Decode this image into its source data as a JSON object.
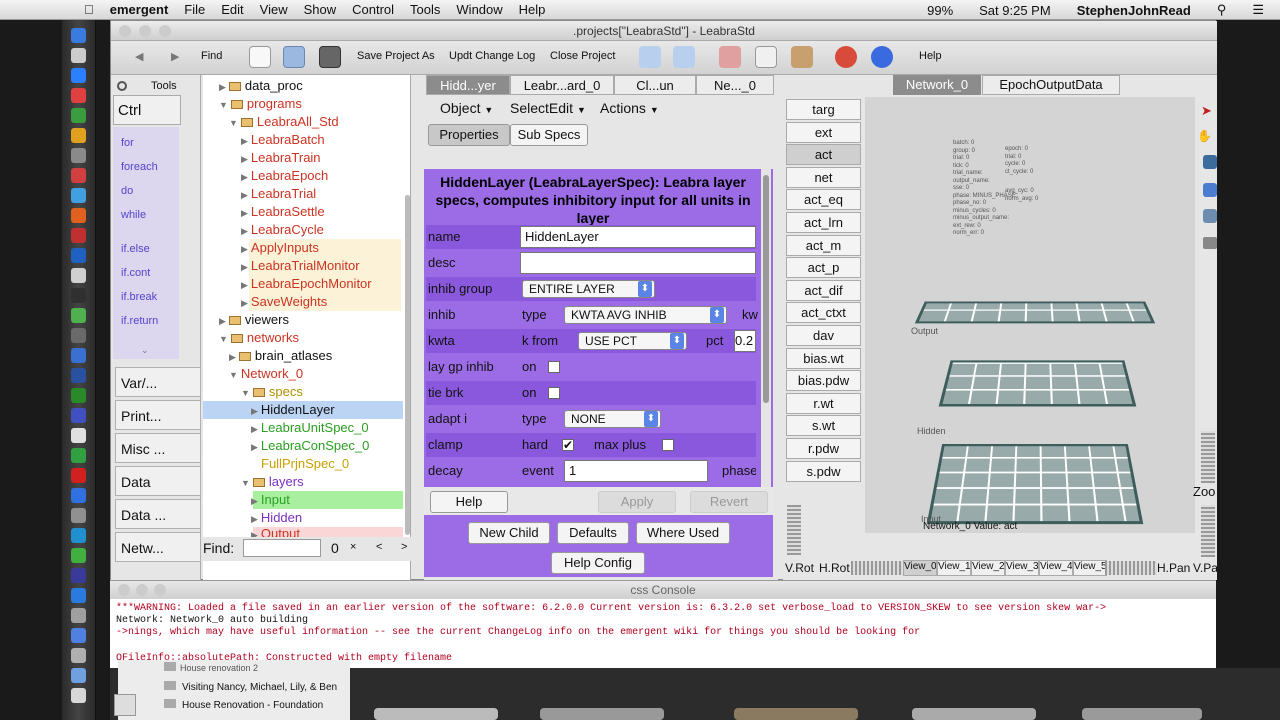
{
  "menubar": {
    "items": [
      "emergent",
      "File",
      "Edit",
      "View",
      "Show",
      "Control",
      "Tools",
      "Window",
      "Help"
    ],
    "battery": "99%",
    "clock": "Sat 9:25 PM",
    "user": "StephenJohnRead"
  },
  "window": {
    "title": ".projects[\"LeabraStd\"] - LeabraStd"
  },
  "toolbar": {
    "find": "Find",
    "save_as": "Save Project As",
    "updt_log": "Updt Change Log",
    "close_proj": "Close Project",
    "help": "Help"
  },
  "leftpane": {
    "tools": "Tools",
    "ctrl": "Ctrl",
    "codes": [
      "for",
      "foreach",
      "do",
      "while",
      "if.else",
      "if.cont",
      "if.break",
      "if.return"
    ],
    "tabs": [
      "Var/...",
      "Print...",
      "Misc ...",
      "Data",
      "Data ...",
      "Netw..."
    ]
  },
  "tree": {
    "nodes": [
      {
        "label": "data_proc",
        "color": "#111"
      },
      {
        "label": "programs",
        "color": "#cc3322"
      },
      {
        "label": "LeabraAll_Std",
        "color": "#cc3322"
      },
      {
        "label": "LeabraBatch",
        "color": "#cc3322"
      },
      {
        "label": "LeabraTrain",
        "color": "#cc3322"
      },
      {
        "label": "LeabraEpoch",
        "color": "#cc3322"
      },
      {
        "label": "LeabraTrial",
        "color": "#cc3322"
      },
      {
        "label": "LeabraSettle",
        "color": "#cc3322"
      },
      {
        "label": "LeabraCycle",
        "color": "#cc3322"
      },
      {
        "label": "ApplyInputs",
        "color": "#cc3322"
      },
      {
        "label": "LeabraTrialMonitor",
        "color": "#cc3322"
      },
      {
        "label": "LeabraEpochMonitor",
        "color": "#cc3322"
      },
      {
        "label": "SaveWeights",
        "color": "#cc3322"
      },
      {
        "label": "viewers",
        "color": "#111"
      },
      {
        "label": "networks",
        "color": "#cc3322"
      },
      {
        "label": "brain_atlases",
        "color": "#111"
      },
      {
        "label": "Network_0",
        "color": "#cc3322"
      },
      {
        "label": "specs",
        "color": "#b09000"
      },
      {
        "label": "HiddenLayer",
        "color": "#111"
      },
      {
        "label": "LeabraUnitSpec_0",
        "color": "#2aa020"
      },
      {
        "label": "LeabraConSpec_0",
        "color": "#2aa020"
      },
      {
        "label": "FullPrjnSpec_0",
        "color": "#c8a000"
      },
      {
        "label": "layers",
        "color": "#7a30c0"
      },
      {
        "label": "Input",
        "color": "#2aa020"
      },
      {
        "label": "Hidden",
        "color": "#7a30c0"
      },
      {
        "label": "Output",
        "color": "#cc3322"
      }
    ],
    "find_label": "Find:",
    "find_count": "0",
    "find_x": "×",
    "find_prev": "<",
    "find_next": ">"
  },
  "mid": {
    "tabs": [
      "Hidd...yer",
      "Leabr...ard_0",
      "Cl...un",
      "Ne..._0"
    ],
    "menus": [
      "Object",
      "SelectEdit",
      "Actions"
    ],
    "subtabs": [
      "Properties",
      "Sub Specs"
    ],
    "heading": "HiddenLayer (LeabraLayerSpec):  Leabra layer specs, computes inhibitory input for all units in layer",
    "rows": {
      "name": "name",
      "name_val": "HiddenLayer",
      "desc": "desc",
      "inhib_group": "inhib group",
      "inhib_group_val": "ENTIRE LAYER",
      "inhib": "inhib",
      "type": "type",
      "inhib_type_val": "KWTA AVG INHIB",
      "kw": "kw",
      "kwta": "kwta",
      "kfrom": "k from",
      "kfrom_val": "USE PCT",
      "pct": "pct",
      "pct_val": "0.2",
      "laygp": "lay gp inhib",
      "on": "on",
      "tiebrk": "tie brk",
      "adapt": "adapt i",
      "adapt_val": "NONE",
      "clamp": "clamp",
      "hard": "hard",
      "maxplus": "max plus",
      "decay": "decay",
      "event": "event",
      "event_val": "1",
      "phase": "phase"
    },
    "buttons": {
      "help": "Help",
      "apply": "Apply",
      "revert": "Revert",
      "new_child": "New Child",
      "defaults": "Defaults",
      "where_used": "Where Used",
      "help_config": "Help Config"
    }
  },
  "right": {
    "tabs": [
      "Network_0",
      "EpochOutputData"
    ],
    "vars": [
      "targ",
      "ext",
      "act",
      "net",
      "act_eq",
      "act_lrn",
      "act_m",
      "act_p",
      "act_dif",
      "act_ctxt",
      "dav",
      "bias.wt",
      "bias.pdw",
      "r.wt",
      "s.wt",
      "r.pdw",
      "s.pdw"
    ],
    "layer_labels": [
      "Output",
      "Hidden",
      "Input"
    ],
    "value_label": "Network_0 Value: act",
    "zoom": "Zoo",
    "bottom": {
      "vrot": "V.Rot",
      "hrot": "H.Rot",
      "views": [
        "View_0",
        "View_1",
        "View_2",
        "View_3",
        "View_4",
        "View_5"
      ],
      "hpan": "H.Pan",
      "vpan": "V.Pa"
    },
    "monitor_text": [
      "batch: 0",
      "group: 0",
      "trial: 0",
      "tick: 0",
      "trial_name:",
      "output_name:",
      "sse: 0",
      "phase: MINUS_PHASE",
      "phase_no: 0",
      "minus_cycles: 0",
      "minus_output_name:",
      "ext_rew: 0",
      "norm_err: 0",
      "epoch: 0",
      "trial: 0",
      "cycle: 0",
      "ct_cycle: 0",
      "avg_cyc: 0",
      "norm_avg: 0"
    ]
  },
  "console": {
    "title": "css Console",
    "lines": [
      "***WARNING: Loaded a file saved in an earlier version of the software: 6.2.0.0   Current version is: 6.3.2.0 set verbose_load to VERSION_SKEW to see version skew war->",
      "Network: Network_0 auto building",
      "->nings, which may have useful information -- see the current ChangeLog info on the emergent wiki for things you should be looking for",
      "",
      "QFileInfo::absolutePath: Constructed with empty filename"
    ]
  },
  "finder": {
    "items": [
      "House renovation 2",
      "Visiting Nancy, Michael, Lily, & Ben",
      "House Renovation - Foundation"
    ]
  }
}
